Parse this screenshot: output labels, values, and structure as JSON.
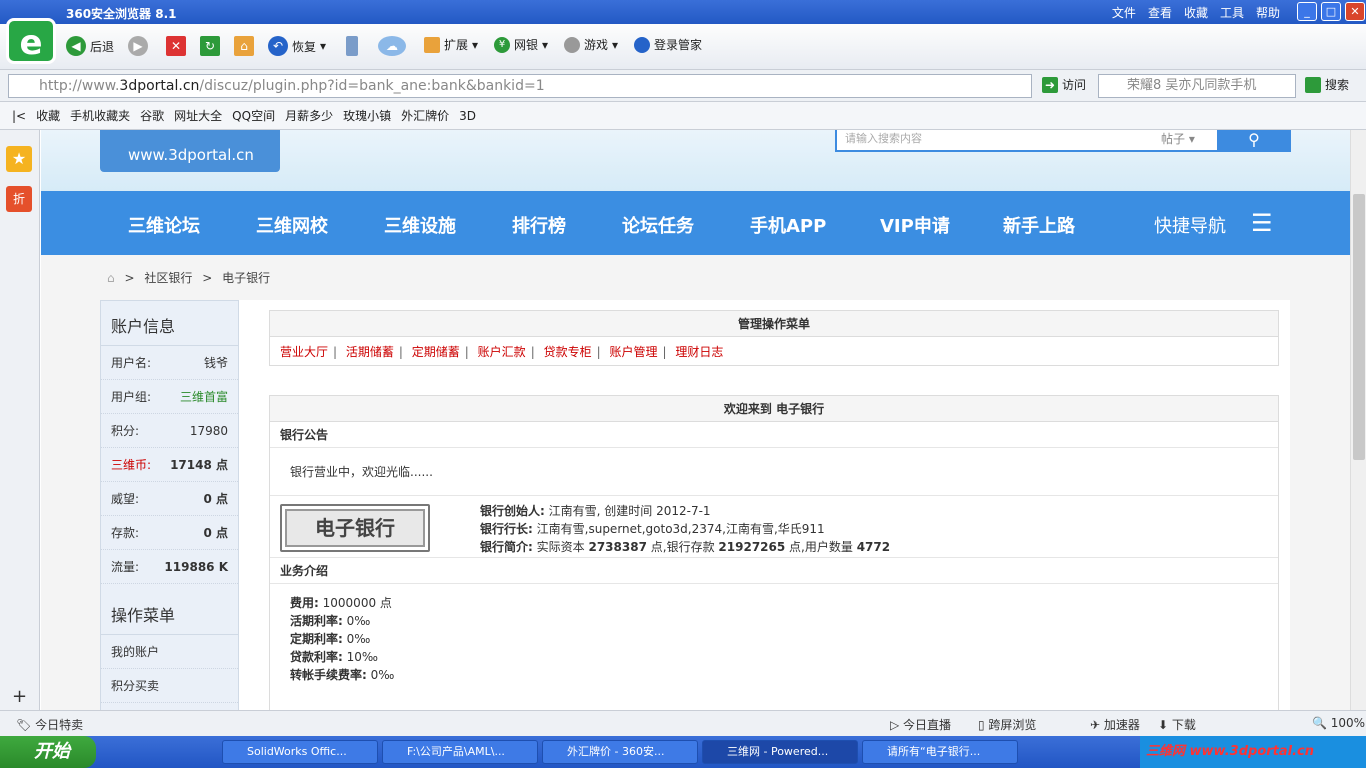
{
  "browser": {
    "title": "360安全浏览器 8.1",
    "menu": [
      "文件",
      "查看",
      "收藏",
      "工具",
      "帮助"
    ],
    "toolbar": {
      "back": "后退",
      "restore": "恢复",
      "ext": "扩展",
      "bank": "网银",
      "games": "游戏",
      "login": "登录管家"
    },
    "url_prefix": "http://www.",
    "url_domain": "3dportal.cn",
    "url_rest": "/discuz/plugin.php?id=bank_ane:bank&bankid=1",
    "visit": "访问",
    "search_placeholder": "荣耀8 吴亦凡同款手机",
    "search_btn": "搜索",
    "bookmarks": [
      "收藏",
      "手机收藏夹",
      "谷歌",
      "网址大全",
      "QQ空间",
      "月薪多少",
      "玫瑰小镇",
      "外汇牌价",
      "3D"
    ]
  },
  "site": {
    "logo_url": "www.3dportal.cn",
    "search_placeholder": "请输入搜索内容",
    "search_type": "帖子",
    "nav": [
      "三维论坛",
      "三维网校",
      "三维设施",
      "排行榜",
      "论坛任务",
      "手机APP",
      "VIP申请",
      "新手上路",
      "快捷导航"
    ],
    "breadcrumb": {
      "sep": ">",
      "items": [
        "社区银行",
        "电子银行"
      ]
    }
  },
  "account": {
    "title": "账户信息",
    "rows": [
      {
        "k": "用户名:",
        "v": "钱爷"
      },
      {
        "k": "用户组:",
        "v": "三维首富"
      },
      {
        "k": "积分:",
        "v": "17980"
      },
      {
        "k": "三维币:",
        "v": "17148 点"
      },
      {
        "k": "威望:",
        "v": "0 点"
      },
      {
        "k": "存款:",
        "v": "0 点"
      },
      {
        "k": "流量:",
        "v": "119886 K"
      }
    ],
    "menu_title": "操作菜单",
    "menu_items": [
      "我的账户",
      "积分买卖"
    ]
  },
  "manage": {
    "title": "管理操作菜单",
    "items": [
      "营业大厅",
      "活期储蓄",
      "定期储蓄",
      "账户汇款",
      "贷款专柜",
      "账户管理",
      "理财日志"
    ]
  },
  "welcome": {
    "title": "欢迎来到 电子银行",
    "notice_title": "银行公告",
    "notice": "银行营业中，欢迎光临......",
    "bank_logo": "电子银行",
    "founder_label": "银行创始人:",
    "founder": "江南有雪, 创建时间 2012-7-1",
    "president_label": "银行行长:",
    "president": "江南有雪,supernet,goto3d,2374,江南有雪,华氏911",
    "intro_label": "银行简介:",
    "intro_a": "实际资本",
    "capital": "2738387",
    "intro_b": "点,银行存款",
    "deposit": "21927265",
    "intro_c": "点,用户数量",
    "users": "4772",
    "biz_title": "业务介绍",
    "rates": [
      {
        "k": "费用:",
        "v": "1000000 点"
      },
      {
        "k": "活期利率:",
        "v": "0‰"
      },
      {
        "k": "定期利率:",
        "v": "0‰"
      },
      {
        "k": "贷款利率:",
        "v": "10‰"
      },
      {
        "k": "转帐手续费率:",
        "v": "0‰"
      }
    ]
  },
  "statusbar": {
    "left": "今日特卖",
    "live": "今日直播",
    "cross": "跨屏浏览",
    "speed": "加速器",
    "download": "下载",
    "zoom": "100%"
  },
  "taskbar": {
    "start": "开始",
    "tasks": [
      "SolidWorks Offic...",
      "F:\\公司产品\\AML\\...",
      "外汇牌价 - 360安...",
      "三维网 - Powered...",
      "请所有“电子银行..."
    ],
    "tray_text": "三维网 www.3dportal.cn"
  }
}
